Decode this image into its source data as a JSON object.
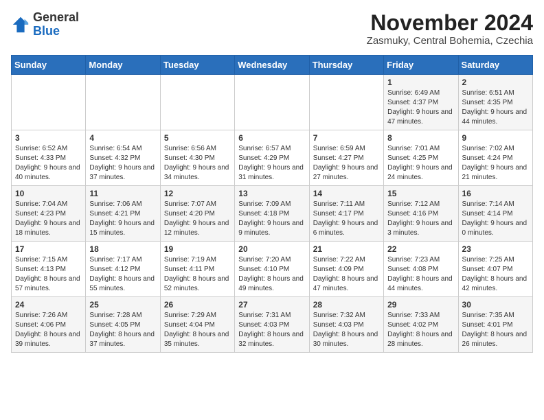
{
  "header": {
    "logo_general": "General",
    "logo_blue": "Blue",
    "month_title": "November 2024",
    "location": "Zasmuky, Central Bohemia, Czechia"
  },
  "weekdays": [
    "Sunday",
    "Monday",
    "Tuesday",
    "Wednesday",
    "Thursday",
    "Friday",
    "Saturday"
  ],
  "weeks": [
    [
      {
        "day": "",
        "info": ""
      },
      {
        "day": "",
        "info": ""
      },
      {
        "day": "",
        "info": ""
      },
      {
        "day": "",
        "info": ""
      },
      {
        "day": "",
        "info": ""
      },
      {
        "day": "1",
        "info": "Sunrise: 6:49 AM\nSunset: 4:37 PM\nDaylight: 9 hours and 47 minutes."
      },
      {
        "day": "2",
        "info": "Sunrise: 6:51 AM\nSunset: 4:35 PM\nDaylight: 9 hours and 44 minutes."
      }
    ],
    [
      {
        "day": "3",
        "info": "Sunrise: 6:52 AM\nSunset: 4:33 PM\nDaylight: 9 hours and 40 minutes."
      },
      {
        "day": "4",
        "info": "Sunrise: 6:54 AM\nSunset: 4:32 PM\nDaylight: 9 hours and 37 minutes."
      },
      {
        "day": "5",
        "info": "Sunrise: 6:56 AM\nSunset: 4:30 PM\nDaylight: 9 hours and 34 minutes."
      },
      {
        "day": "6",
        "info": "Sunrise: 6:57 AM\nSunset: 4:29 PM\nDaylight: 9 hours and 31 minutes."
      },
      {
        "day": "7",
        "info": "Sunrise: 6:59 AM\nSunset: 4:27 PM\nDaylight: 9 hours and 27 minutes."
      },
      {
        "day": "8",
        "info": "Sunrise: 7:01 AM\nSunset: 4:25 PM\nDaylight: 9 hours and 24 minutes."
      },
      {
        "day": "9",
        "info": "Sunrise: 7:02 AM\nSunset: 4:24 PM\nDaylight: 9 hours and 21 minutes."
      }
    ],
    [
      {
        "day": "10",
        "info": "Sunrise: 7:04 AM\nSunset: 4:23 PM\nDaylight: 9 hours and 18 minutes."
      },
      {
        "day": "11",
        "info": "Sunrise: 7:06 AM\nSunset: 4:21 PM\nDaylight: 9 hours and 15 minutes."
      },
      {
        "day": "12",
        "info": "Sunrise: 7:07 AM\nSunset: 4:20 PM\nDaylight: 9 hours and 12 minutes."
      },
      {
        "day": "13",
        "info": "Sunrise: 7:09 AM\nSunset: 4:18 PM\nDaylight: 9 hours and 9 minutes."
      },
      {
        "day": "14",
        "info": "Sunrise: 7:11 AM\nSunset: 4:17 PM\nDaylight: 9 hours and 6 minutes."
      },
      {
        "day": "15",
        "info": "Sunrise: 7:12 AM\nSunset: 4:16 PM\nDaylight: 9 hours and 3 minutes."
      },
      {
        "day": "16",
        "info": "Sunrise: 7:14 AM\nSunset: 4:14 PM\nDaylight: 9 hours and 0 minutes."
      }
    ],
    [
      {
        "day": "17",
        "info": "Sunrise: 7:15 AM\nSunset: 4:13 PM\nDaylight: 8 hours and 57 minutes."
      },
      {
        "day": "18",
        "info": "Sunrise: 7:17 AM\nSunset: 4:12 PM\nDaylight: 8 hours and 55 minutes."
      },
      {
        "day": "19",
        "info": "Sunrise: 7:19 AM\nSunset: 4:11 PM\nDaylight: 8 hours and 52 minutes."
      },
      {
        "day": "20",
        "info": "Sunrise: 7:20 AM\nSunset: 4:10 PM\nDaylight: 8 hours and 49 minutes."
      },
      {
        "day": "21",
        "info": "Sunrise: 7:22 AM\nSunset: 4:09 PM\nDaylight: 8 hours and 47 minutes."
      },
      {
        "day": "22",
        "info": "Sunrise: 7:23 AM\nSunset: 4:08 PM\nDaylight: 8 hours and 44 minutes."
      },
      {
        "day": "23",
        "info": "Sunrise: 7:25 AM\nSunset: 4:07 PM\nDaylight: 8 hours and 42 minutes."
      }
    ],
    [
      {
        "day": "24",
        "info": "Sunrise: 7:26 AM\nSunset: 4:06 PM\nDaylight: 8 hours and 39 minutes."
      },
      {
        "day": "25",
        "info": "Sunrise: 7:28 AM\nSunset: 4:05 PM\nDaylight: 8 hours and 37 minutes."
      },
      {
        "day": "26",
        "info": "Sunrise: 7:29 AM\nSunset: 4:04 PM\nDaylight: 8 hours and 35 minutes."
      },
      {
        "day": "27",
        "info": "Sunrise: 7:31 AM\nSunset: 4:03 PM\nDaylight: 8 hours and 32 minutes."
      },
      {
        "day": "28",
        "info": "Sunrise: 7:32 AM\nSunset: 4:03 PM\nDaylight: 8 hours and 30 minutes."
      },
      {
        "day": "29",
        "info": "Sunrise: 7:33 AM\nSunset: 4:02 PM\nDaylight: 8 hours and 28 minutes."
      },
      {
        "day": "30",
        "info": "Sunrise: 7:35 AM\nSunset: 4:01 PM\nDaylight: 8 hours and 26 minutes."
      }
    ]
  ]
}
